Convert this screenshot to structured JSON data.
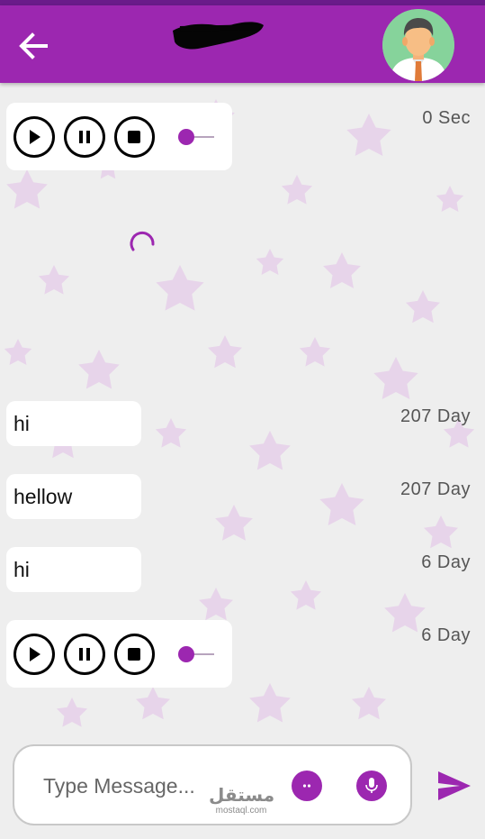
{
  "colors": {
    "primary": "#9c27b0",
    "primary_dark": "#6a1b8a",
    "bubble": "#ffffff",
    "time_text": "#555555",
    "star": "#e3c9e8"
  },
  "header": {
    "back_icon": "arrow-left-icon",
    "contact_name": "",
    "avatar_icon": "user-avatar"
  },
  "messages": [
    {
      "type": "audio",
      "time": "0 Sec",
      "progress": 0
    },
    {
      "type": "loading"
    },
    {
      "type": "text",
      "text": "hi",
      "time": "207 Day"
    },
    {
      "type": "text",
      "text": "hellow",
      "time": "207 Day"
    },
    {
      "type": "text",
      "text": "hi",
      "time": "6 Day"
    },
    {
      "type": "audio",
      "time": "6 Day",
      "progress": 0
    }
  ],
  "audio_controls": [
    "play-icon",
    "pause-icon",
    "stop-icon"
  ],
  "input": {
    "placeholder": "Type Message...",
    "emoji_icon": "emoji-icon",
    "mic_icon": "microphone-icon",
    "send_icon": "send-icon"
  },
  "watermark": {
    "arabic": "مستقل",
    "latin": "mostaql.com"
  }
}
